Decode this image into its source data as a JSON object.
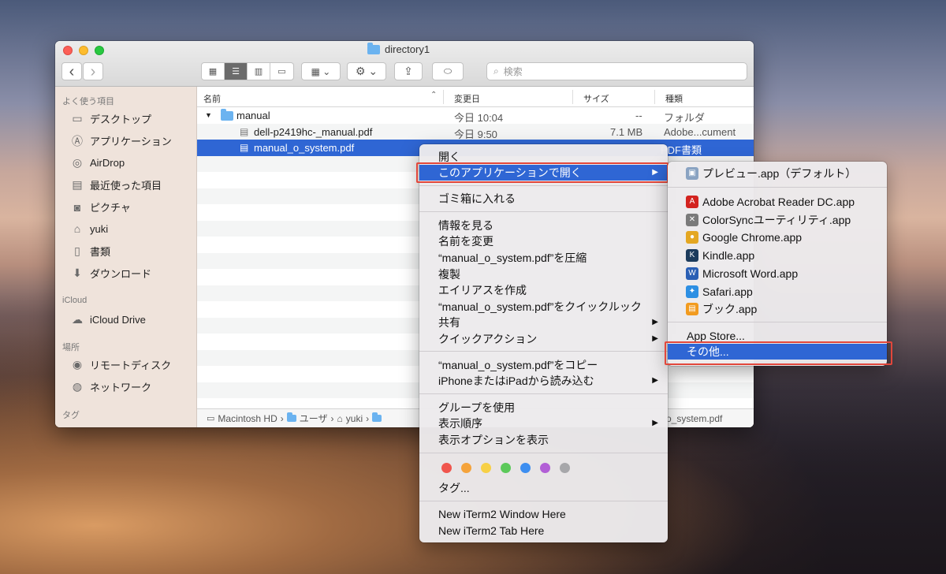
{
  "window": {
    "title": "directory1"
  },
  "toolbar": {
    "back_icon": "‹",
    "forward_icon": "›",
    "search_placeholder": "検索"
  },
  "sidebar": {
    "favorites_header": "よく使う項目",
    "favorites": [
      "デスクトップ",
      "アプリケーション",
      "AirDrop",
      "最近使った項目",
      "ピクチャ",
      "yuki",
      "書類",
      "ダウンロード"
    ],
    "icloud_header": "iCloud",
    "icloud": [
      "iCloud Drive"
    ],
    "places_header": "場所",
    "places": [
      "リモートディスク",
      "ネットワーク"
    ],
    "tags_header": "タグ"
  },
  "columns": {
    "name": "名前",
    "date": "変更日",
    "size": "サイズ",
    "kind": "種類"
  },
  "files": [
    {
      "name": "manual",
      "date": "今日 10:04",
      "size": "--",
      "kind": "フォルダ"
    },
    {
      "name": "dell-p2419hc-_manual.pdf",
      "date": "今日 9:50",
      "size": "7.1 MB",
      "kind": "Adobe...cument"
    },
    {
      "name": "manual_o_system.pdf",
      "date": "",
      "size": "",
      "kind": "PDF書類"
    }
  ],
  "pathbar": {
    "items": [
      "Macintosh HD",
      "ユーザ",
      "yuki"
    ],
    "tail": "o_system.pdf"
  },
  "context_menu": {
    "open": "開く",
    "open_with": "このアプリケーションで開く",
    "trash": "ゴミ箱に入れる",
    "get_info": "情報を見る",
    "rename": "名前を変更",
    "compress": "“manual_o_system.pdf”を圧縮",
    "duplicate": "複製",
    "make_alias": "エイリアスを作成",
    "quicklook": "“manual_o_system.pdf”をクイックルック",
    "share": "共有",
    "quick_actions": "クイックアクション",
    "copy": "“manual_o_system.pdf”をコピー",
    "import_iphone": "iPhoneまたはiPadから読み込む",
    "use_groups": "グループを使用",
    "sort_by": "表示順序",
    "view_options": "表示オプションを表示",
    "tags": "タグ...",
    "iterm_window": "New iTerm2 Window Here",
    "iterm_tab": "New iTerm2 Tab Here",
    "tag_colors": [
      "#f0554d",
      "#f5a33b",
      "#f7d046",
      "#5cc95a",
      "#3d8ef0",
      "#b25fd6",
      "#a7a7aa"
    ]
  },
  "submenu": {
    "default_app": "プレビュー.app（デフォルト）",
    "apps": [
      {
        "label": "Adobe Acrobat Reader DC.app",
        "icon": "acrobat-icon",
        "color": "#d3231f"
      },
      {
        "label": "ColorSyncユーティリティ.app",
        "icon": "colorsync-icon",
        "color": "#7a7a7a"
      },
      {
        "label": "Google Chrome.app",
        "icon": "chrome-icon",
        "color": "#e4a722"
      },
      {
        "label": "Kindle.app",
        "icon": "kindle-icon",
        "color": "#1c3b5c"
      },
      {
        "label": "Microsoft Word.app",
        "icon": "word-icon",
        "color": "#2a5fb4"
      },
      {
        "label": "Safari.app",
        "icon": "safari-icon",
        "color": "#2d8fe3"
      },
      {
        "label": "ブック.app",
        "icon": "books-icon",
        "color": "#f29b1f"
      }
    ],
    "app_store": "App Store...",
    "other": "その他..."
  }
}
